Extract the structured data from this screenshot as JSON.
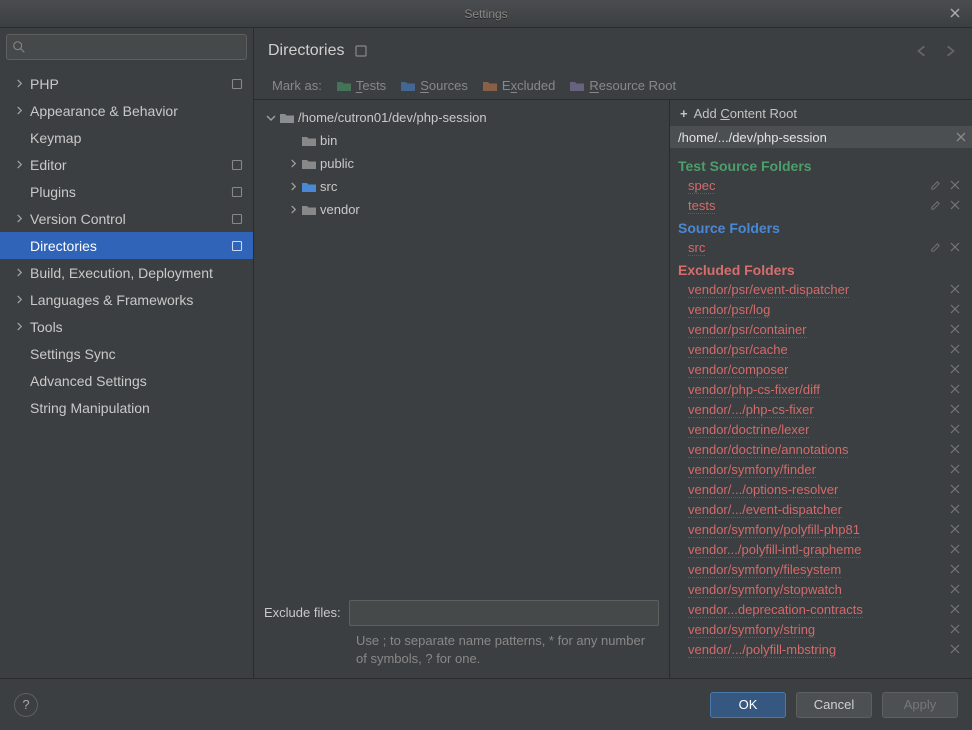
{
  "window": {
    "title": "Settings"
  },
  "search": {
    "placeholder": ""
  },
  "nav": [
    {
      "label": "PHP",
      "hasChevron": true,
      "selected": false,
      "hasPersist": true
    },
    {
      "label": "Appearance & Behavior",
      "hasChevron": true,
      "selected": false
    },
    {
      "label": "Keymap",
      "hasChevron": false,
      "selected": false
    },
    {
      "label": "Editor",
      "hasChevron": true,
      "selected": false,
      "hasPersist": true
    },
    {
      "label": "Plugins",
      "hasChevron": false,
      "selected": false,
      "hasPersist": true
    },
    {
      "label": "Version Control",
      "hasChevron": true,
      "selected": false,
      "hasPersist": true
    },
    {
      "label": "Directories",
      "hasChevron": false,
      "selected": true,
      "indent": true,
      "hasPersist": true
    },
    {
      "label": "Build, Execution, Deployment",
      "hasChevron": true,
      "selected": false
    },
    {
      "label": "Languages & Frameworks",
      "hasChevron": true,
      "selected": false
    },
    {
      "label": "Tools",
      "hasChevron": true,
      "selected": false
    },
    {
      "label": "Settings Sync",
      "hasChevron": false,
      "selected": false
    },
    {
      "label": "Advanced Settings",
      "hasChevron": false,
      "selected": false
    },
    {
      "label": "String Manipulation",
      "hasChevron": false,
      "selected": false
    }
  ],
  "header": {
    "title": "Directories"
  },
  "markas": {
    "label": "Mark as:",
    "items": [
      {
        "prefix": "",
        "ul": "T",
        "rest": "ests",
        "color": "#4c9e6b"
      },
      {
        "prefix": "",
        "ul": "S",
        "rest": "ources",
        "color": "#4a88d6"
      },
      {
        "prefix": "E",
        "ul": "x",
        "rest": "cluded",
        "color": "#c97b4a"
      },
      {
        "prefix": "",
        "ul": "R",
        "rest": "esource Root",
        "color": "#8a7fae"
      }
    ]
  },
  "tree": {
    "root": "/home/cutron01/dev/php-session",
    "children": [
      {
        "label": "bin",
        "hasChildren": false,
        "color": "#888"
      },
      {
        "label": "public",
        "hasChildren": true,
        "color": "#888"
      },
      {
        "label": "src",
        "hasChildren": true,
        "color": "#4a88d6"
      },
      {
        "label": "vendor",
        "hasChildren": true,
        "color": "#888"
      }
    ]
  },
  "exclude": {
    "label": "Exclude files:",
    "value": "",
    "hint": "Use ; to separate name patterns, * for any number of symbols, ? for one."
  },
  "addRoot": {
    "label": "Add Content Root",
    "ul": "C"
  },
  "rootPath": "/home/.../dev/php-session",
  "sections": [
    {
      "title": "Test Source Folders",
      "class": "test",
      "items": [
        {
          "name": "spec",
          "edit": true
        },
        {
          "name": "tests",
          "edit": true
        }
      ]
    },
    {
      "title": "Source Folders",
      "class": "source",
      "items": [
        {
          "name": "src",
          "edit": true
        }
      ]
    },
    {
      "title": "Excluded Folders",
      "class": "excluded",
      "items": [
        {
          "name": "vendor/psr/event-dispatcher"
        },
        {
          "name": "vendor/psr/log"
        },
        {
          "name": "vendor/psr/container"
        },
        {
          "name": "vendor/psr/cache"
        },
        {
          "name": "vendor/composer"
        },
        {
          "name": "vendor/php-cs-fixer/diff"
        },
        {
          "name": "vendor/.../php-cs-fixer"
        },
        {
          "name": "vendor/doctrine/lexer"
        },
        {
          "name": "vendor/doctrine/annotations"
        },
        {
          "name": "vendor/symfony/finder"
        },
        {
          "name": "vendor/.../options-resolver"
        },
        {
          "name": "vendor/.../event-dispatcher"
        },
        {
          "name": "vendor/symfony/polyfill-php81"
        },
        {
          "name": "vendor.../polyfill-intl-grapheme"
        },
        {
          "name": "vendor/symfony/filesystem"
        },
        {
          "name": "vendor/symfony/stopwatch"
        },
        {
          "name": "vendor...deprecation-contracts"
        },
        {
          "name": "vendor/symfony/string"
        },
        {
          "name": "vendor/.../polyfill-mbstring"
        }
      ]
    }
  ],
  "footer": {
    "ok": "OK",
    "cancel": "Cancel",
    "apply": "Apply",
    "help": "?"
  }
}
